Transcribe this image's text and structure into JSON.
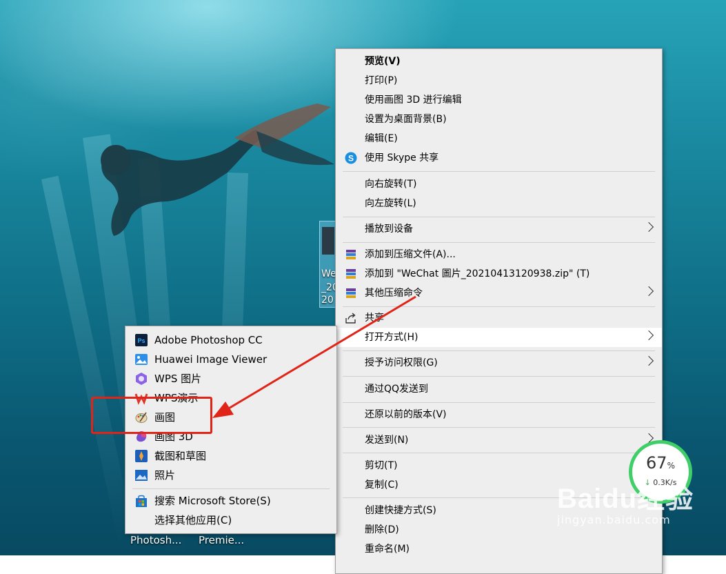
{
  "desktop": {
    "selected_icon_label_lines": [
      "We",
      "_20",
      "20"
    ],
    "taskbar_labels": [
      "Photosh...",
      "Premie..."
    ]
  },
  "context_menu": {
    "items": [
      {
        "label": "预览(V)",
        "bold": true
      },
      {
        "label": "打印(P)"
      },
      {
        "label": "使用画图 3D 进行编辑"
      },
      {
        "label": "设置为桌面背景(B)"
      },
      {
        "label": "编辑(E)"
      },
      {
        "label": "使用 Skype 共享",
        "icon": "skype-icon"
      },
      {
        "label": "向右旋转(T)"
      },
      {
        "label": "向左旋转(L)"
      },
      {
        "label": "播放到设备",
        "submenu": true
      },
      {
        "label": "添加到压缩文件(A)...",
        "icon": "winrar-icon"
      },
      {
        "label": "添加到 \"WeChat 圖片_20210413120938.zip\" (T)",
        "icon": "winrar-icon"
      },
      {
        "label": "其他压缩命令",
        "icon": "winrar-icon",
        "submenu": true
      },
      {
        "label": "共享",
        "icon": "share-icon"
      },
      {
        "label": "打开方式(H)",
        "submenu": true,
        "highlighted": true
      },
      {
        "label": "授予访问权限(G)",
        "submenu": true
      },
      {
        "label": "通过QQ发送到"
      },
      {
        "label": "还原以前的版本(V)"
      },
      {
        "label": "发送到(N)",
        "submenu": true
      },
      {
        "label": "剪切(T)"
      },
      {
        "label": "复制(C)"
      },
      {
        "label": "创建快捷方式(S)"
      },
      {
        "label": "删除(D)"
      },
      {
        "label": "重命名(M)"
      }
    ]
  },
  "open_with_submenu": {
    "items": [
      {
        "label": "Adobe Photoshop CC",
        "icon": "photoshop-icon"
      },
      {
        "label": "Huawei Image Viewer",
        "icon": "image-viewer-icon"
      },
      {
        "label": "WPS 图片",
        "icon": "wps-picture-icon"
      },
      {
        "label": "WPS演示",
        "icon": "wps-presentation-icon"
      },
      {
        "label": "画图",
        "icon": "paint-icon"
      },
      {
        "label": "画图 3D",
        "icon": "paint-3d-icon"
      },
      {
        "label": "截图和草图",
        "icon": "snip-sketch-icon"
      },
      {
        "label": "照片",
        "icon": "photos-icon"
      },
      {
        "label": "搜索 Microsoft Store(S)",
        "icon": "store-icon"
      },
      {
        "label": "选择其他应用(C)"
      }
    ]
  },
  "network_widget": {
    "percent": "67",
    "percent_unit": "%",
    "rate": "0.3K/s"
  },
  "watermark": {
    "brand": "Baidu经验",
    "url": "jingyan.baidu.com"
  },
  "colors": {
    "annotation_red": "#e02418",
    "widget_green": "#3fce67",
    "menu_bg": "#eeeeee"
  }
}
